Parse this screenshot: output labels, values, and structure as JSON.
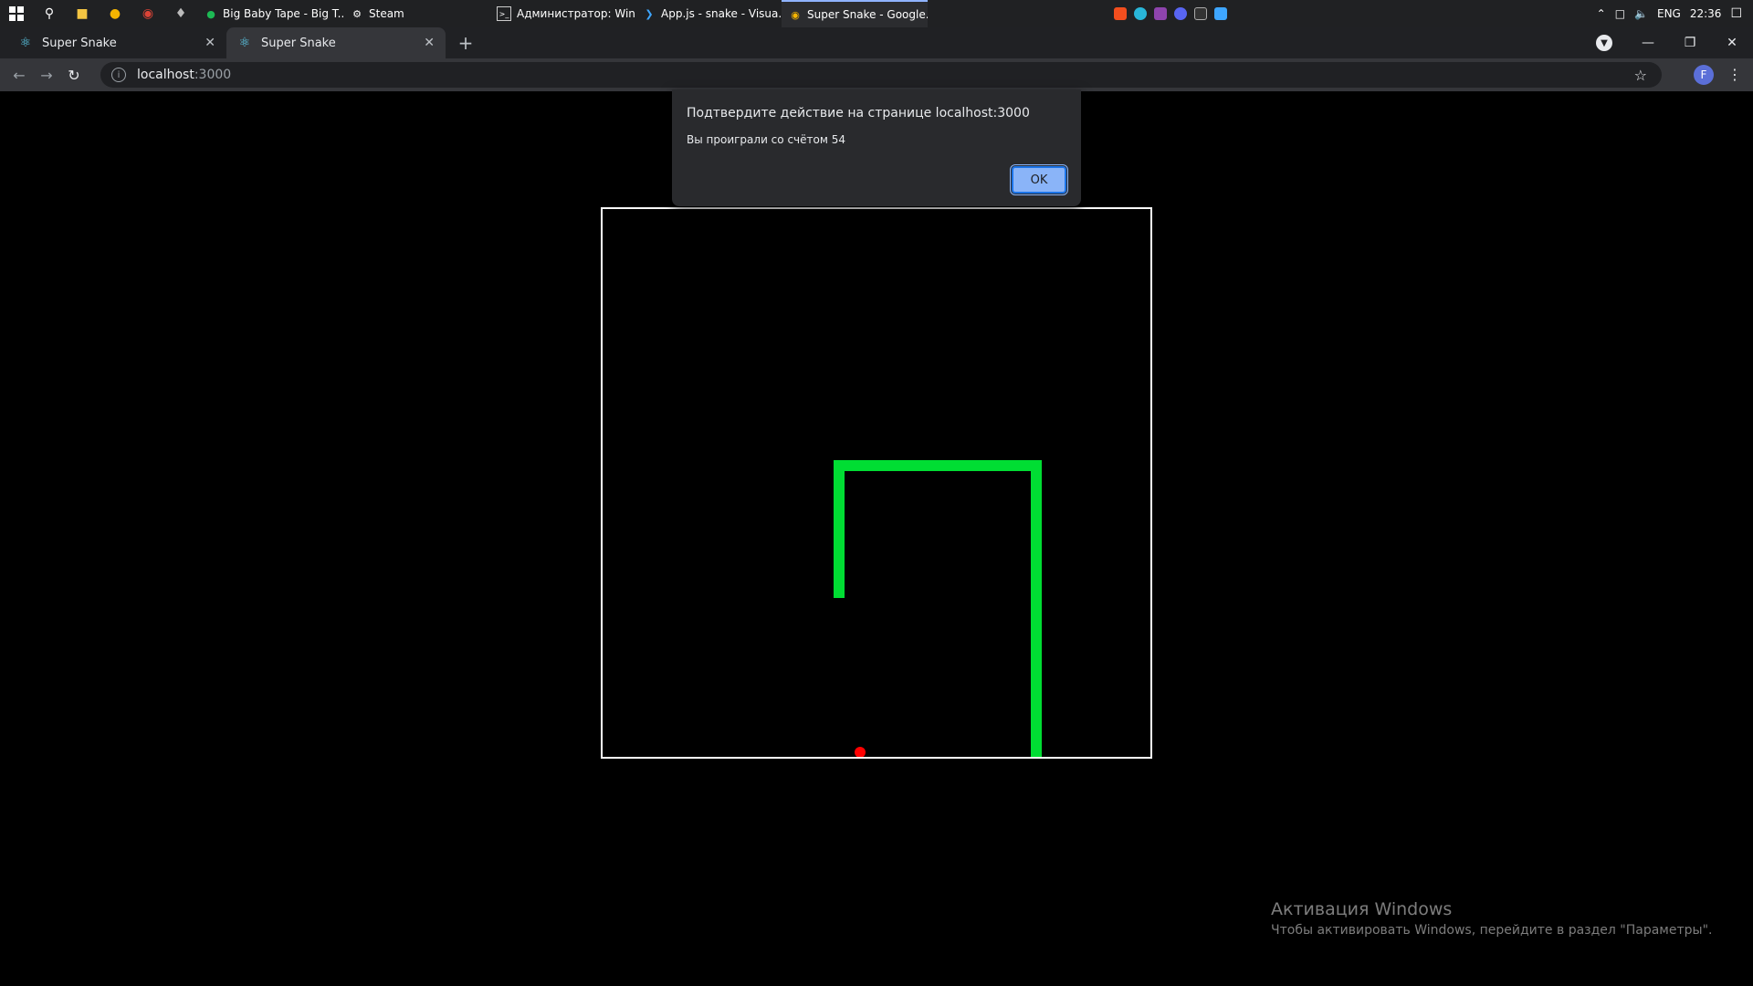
{
  "taskbar": {
    "apps": [
      {
        "label": "Big Baby Tape - Big T...",
        "icon": "spotify-icon",
        "color": "#1db954"
      },
      {
        "label": "Steam",
        "icon": "steam-icon",
        "color": "#ffffff"
      },
      {
        "label": "Администратор: Win...",
        "icon": "cmd-icon",
        "color": "#cccccc"
      },
      {
        "label": "App.js - snake - Visua...",
        "icon": "vscode-icon",
        "color": "#3ea6ff"
      },
      {
        "label": "Super Snake - Google...",
        "icon": "chrome-icon",
        "color": "#f4b400"
      }
    ],
    "tray": {
      "language": "ENG",
      "time": "22:36"
    }
  },
  "browser": {
    "tabs": [
      {
        "title": "Super Snake",
        "active": false
      },
      {
        "title": "Super Snake",
        "active": true
      }
    ],
    "address": {
      "host": "localhost",
      "port": ":3000"
    },
    "profile_initial": "F"
  },
  "dialog": {
    "title": "Подтвердите действие на странице localhost:3000",
    "message": "Вы проиграли со счётом 54",
    "ok_label": "OK"
  },
  "game": {
    "snake_color": "#00dd33",
    "food_color": "#ff0000",
    "border_color": "#ffffff"
  },
  "watermark": {
    "title": "Активация Windows",
    "subtitle": "Чтобы активировать Windows, перейдите в раздел \"Параметры\"."
  }
}
